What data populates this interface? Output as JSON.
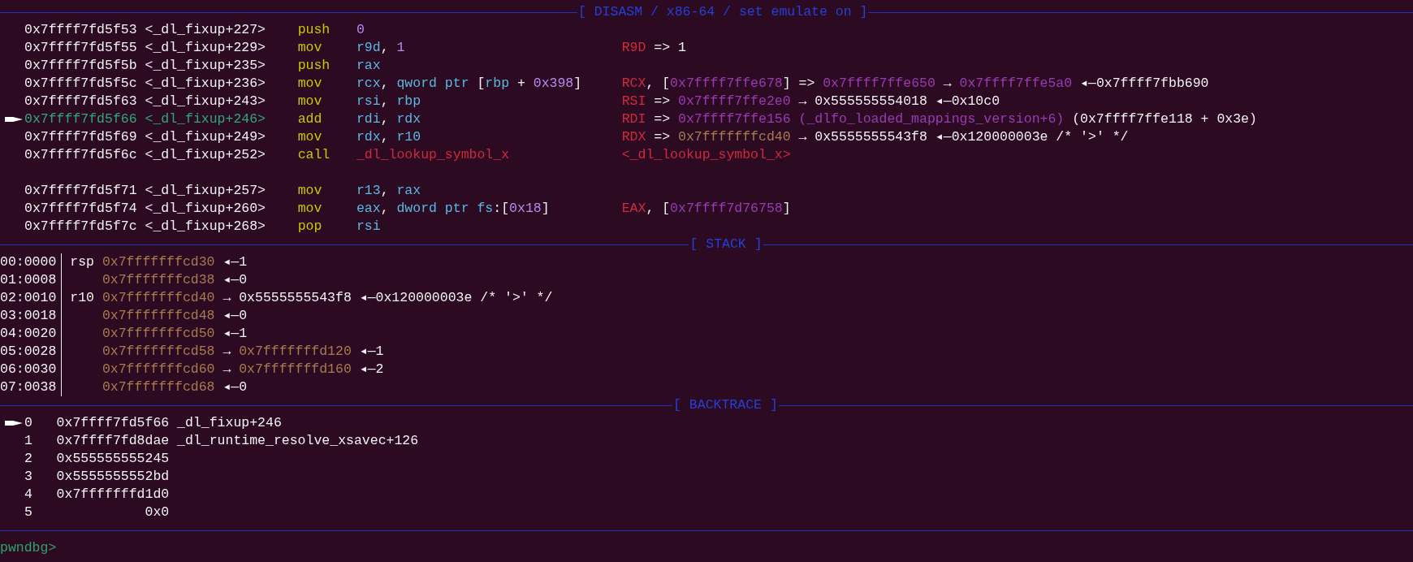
{
  "disasm": {
    "title": "[ DISASM / x86-64 / set emulate on ]",
    "rows": [
      {
        "kind": "instr",
        "current": false,
        "address": "0x7ffff7fd5f53",
        "symbol": "<_dl_fixup+227>",
        "mnemonic": "push",
        "operands": [
          {
            "text": "0",
            "kind": "imm"
          }
        ]
      },
      {
        "kind": "instr",
        "current": false,
        "address": "0x7ffff7fd5f55",
        "symbol": "<_dl_fixup+229>",
        "mnemonic": "mov",
        "operands": [
          {
            "text": "r9d",
            "kind": "reg"
          },
          {
            "text": ",",
            "kind": "text",
            "tight": true
          },
          {
            "text": "1",
            "kind": "imm"
          }
        ],
        "annotation": [
          {
            "text": "R9D",
            "kind": "regname"
          },
          {
            "text": "=>",
            "kind": "text"
          },
          {
            "text": "1",
            "kind": "text"
          }
        ]
      },
      {
        "kind": "instr",
        "current": false,
        "address": "0x7ffff7fd5f5b",
        "symbol": "<_dl_fixup+235>",
        "mnemonic": "push",
        "operands": [
          {
            "text": "rax",
            "kind": "reg"
          }
        ]
      },
      {
        "kind": "instr",
        "current": false,
        "address": "0x7ffff7fd5f5c",
        "symbol": "<_dl_fixup+236>",
        "mnemonic": "mov",
        "operands": [
          {
            "text": "rcx",
            "kind": "reg"
          },
          {
            "text": ",",
            "kind": "text",
            "tight": true
          },
          {
            "text": "qword ptr",
            "kind": "reg"
          },
          {
            "text": "[",
            "kind": "text"
          },
          {
            "text": "rbp",
            "kind": "reg",
            "tight": true
          },
          {
            "text": "+",
            "kind": "text"
          },
          {
            "text": "0x398",
            "kind": "imm"
          },
          {
            "text": "]",
            "kind": "text",
            "tight": true
          }
        ],
        "annotation": [
          {
            "text": "RCX",
            "kind": "regname"
          },
          {
            "text": ",",
            "kind": "text",
            "tight": true
          },
          {
            "text": "[",
            "kind": "text"
          },
          {
            "text": "0x7ffff7ffe678",
            "kind": "heap",
            "tight": true
          },
          {
            "text": "]",
            "kind": "text",
            "tight": true
          },
          {
            "text": "=>",
            "kind": "text"
          },
          {
            "text": "0x7ffff7ffe650",
            "kind": "heap"
          },
          {
            "text": "→",
            "kind": "text"
          },
          {
            "text": "0x7ffff7ffe5a0",
            "kind": "heap"
          },
          {
            "text": "◂—0x7ffff7fbb690",
            "kind": "text"
          }
        ]
      },
      {
        "kind": "instr",
        "current": false,
        "address": "0x7ffff7fd5f63",
        "symbol": "<_dl_fixup+243>",
        "mnemonic": "mov",
        "operands": [
          {
            "text": "rsi",
            "kind": "reg"
          },
          {
            "text": ",",
            "kind": "text",
            "tight": true
          },
          {
            "text": "rbp",
            "kind": "reg"
          }
        ],
        "annotation": [
          {
            "text": "RSI",
            "kind": "regname"
          },
          {
            "text": "=>",
            "kind": "text"
          },
          {
            "text": "0x7ffff7ffe2e0",
            "kind": "heap"
          },
          {
            "text": "→",
            "kind": "text"
          },
          {
            "text": "0x555555554018",
            "kind": "text"
          },
          {
            "text": "◂—0x10c0",
            "kind": "text"
          }
        ]
      },
      {
        "kind": "instr",
        "current": true,
        "address": "0x7ffff7fd5f66",
        "symbol": "<_dl_fixup+246>",
        "mnemonic": "add",
        "operands": [
          {
            "text": "rdi",
            "kind": "reg"
          },
          {
            "text": ",",
            "kind": "text",
            "tight": true
          },
          {
            "text": "rdx",
            "kind": "reg"
          }
        ],
        "annotation": [
          {
            "text": "RDI",
            "kind": "regname"
          },
          {
            "text": "=>",
            "kind": "text"
          },
          {
            "text": "0x7ffff7ffe156",
            "kind": "heap"
          },
          {
            "text": "(_dlfo_loaded_mappings_version+6)",
            "kind": "heap"
          },
          {
            "text": "(0x7ffff7ffe118 + 0x3e)",
            "kind": "text"
          }
        ]
      },
      {
        "kind": "instr",
        "current": false,
        "address": "0x7ffff7fd5f69",
        "symbol": "<_dl_fixup+249>",
        "mnemonic": "mov",
        "operands": [
          {
            "text": "rdx",
            "kind": "reg"
          },
          {
            "text": ",",
            "kind": "text",
            "tight": true
          },
          {
            "text": "r10",
            "kind": "reg"
          }
        ],
        "annotation": [
          {
            "text": "RDX",
            "kind": "regname"
          },
          {
            "text": "=>",
            "kind": "text"
          },
          {
            "text": "0x7fffffffcd40",
            "kind": "stack"
          },
          {
            "text": "→",
            "kind": "text"
          },
          {
            "text": "0x5555555543f8",
            "kind": "text"
          },
          {
            "text": "◂—0x120000003e /* '>' */",
            "kind": "text"
          }
        ]
      },
      {
        "kind": "call",
        "current": false,
        "address": "0x7ffff7fd5f6c",
        "symbol": "<_dl_fixup+252>",
        "mnemonic": "call",
        "operands": [
          {
            "text": "_dl_lookup_symbol_x",
            "kind": "code"
          }
        ],
        "annotation": [
          {
            "text": "<_dl_lookup_symbol_x>",
            "kind": "code"
          }
        ]
      },
      {
        "kind": "instr",
        "current": false,
        "address": "0x7ffff7fd5f71",
        "symbol": "<_dl_fixup+257>",
        "mnemonic": "mov",
        "operands": [
          {
            "text": "r13",
            "kind": "reg"
          },
          {
            "text": ",",
            "kind": "text",
            "tight": true
          },
          {
            "text": "rax",
            "kind": "reg"
          }
        ]
      },
      {
        "kind": "instr",
        "current": false,
        "address": "0x7ffff7fd5f74",
        "symbol": "<_dl_fixup+260>",
        "mnemonic": "mov",
        "operands": [
          {
            "text": "eax",
            "kind": "reg"
          },
          {
            "text": ",",
            "kind": "text",
            "tight": true
          },
          {
            "text": "dword ptr fs",
            "kind": "reg"
          },
          {
            "text": ":",
            "kind": "text",
            "tight": true
          },
          {
            "text": "[",
            "kind": "text",
            "tight": true
          },
          {
            "text": "0x18",
            "kind": "imm",
            "tight": true
          },
          {
            "text": "]",
            "kind": "text",
            "tight": true
          }
        ],
        "annotation": [
          {
            "text": "EAX",
            "kind": "regname"
          },
          {
            "text": ",",
            "kind": "text",
            "tight": true
          },
          {
            "text": "[",
            "kind": "text"
          },
          {
            "text": "0x7ffff7d76758",
            "kind": "heap",
            "tight": true
          },
          {
            "text": "]",
            "kind": "text",
            "tight": true
          }
        ]
      },
      {
        "kind": "instr",
        "current": false,
        "address": "0x7ffff7fd5f7c",
        "symbol": "<_dl_fixup+268>",
        "mnemonic": "pop",
        "operands": [
          {
            "text": "rsi",
            "kind": "reg"
          }
        ]
      }
    ]
  },
  "stack": {
    "title": "[ STACK ]",
    "rows": [
      {
        "index": "00:0000",
        "register": "rsp",
        "values": [
          {
            "text": "0x7fffffffcd30",
            "kind": "stack"
          },
          {
            "text": "◂—1",
            "kind": "text"
          }
        ]
      },
      {
        "index": "01:0008",
        "values": [
          {
            "text": "0x7fffffffcd38",
            "kind": "stack"
          },
          {
            "text": "◂—0",
            "kind": "text"
          }
        ]
      },
      {
        "index": "02:0010",
        "register": "r10",
        "values": [
          {
            "text": "0x7fffffffcd40",
            "kind": "stack"
          },
          {
            "text": "→",
            "kind": "text"
          },
          {
            "text": "0x5555555543f8",
            "kind": "text"
          },
          {
            "text": "◂—0x120000003e /* '>' */",
            "kind": "text"
          }
        ]
      },
      {
        "index": "03:0018",
        "values": [
          {
            "text": "0x7fffffffcd48",
            "kind": "stack"
          },
          {
            "text": "◂—0",
            "kind": "text"
          }
        ]
      },
      {
        "index": "04:0020",
        "values": [
          {
            "text": "0x7fffffffcd50",
            "kind": "stack"
          },
          {
            "text": "◂—1",
            "kind": "text"
          }
        ]
      },
      {
        "index": "05:0028",
        "values": [
          {
            "text": "0x7fffffffcd58",
            "kind": "stack"
          },
          {
            "text": "→",
            "kind": "text"
          },
          {
            "text": "0x7fffffffd120",
            "kind": "stack"
          },
          {
            "text": "◂—1",
            "kind": "text"
          }
        ]
      },
      {
        "index": "06:0030",
        "values": [
          {
            "text": "0x7fffffffcd60",
            "kind": "stack"
          },
          {
            "text": "→",
            "kind": "text"
          },
          {
            "text": "0x7fffffffd160",
            "kind": "stack"
          },
          {
            "text": "◂—2",
            "kind": "text"
          }
        ]
      },
      {
        "index": "07:0038",
        "values": [
          {
            "text": "0x7fffffffcd68",
            "kind": "stack"
          },
          {
            "text": "◂—0",
            "kind": "text"
          }
        ]
      }
    ]
  },
  "backtrace": {
    "title": "[ BACKTRACE ]",
    "frames": [
      {
        "current": true,
        "index": "0",
        "address": "0x7ffff7fd5f66",
        "symbol": "_dl_fixup+246"
      },
      {
        "current": false,
        "index": "1",
        "address": "0x7ffff7fd8dae",
        "symbol": "_dl_runtime_resolve_xsavec+126"
      },
      {
        "current": false,
        "index": "2",
        "address": "0x555555555245"
      },
      {
        "current": false,
        "index": "3",
        "address": "0x5555555552bd"
      },
      {
        "current": false,
        "index": "4",
        "address": "0x7fffffffd1d0"
      },
      {
        "current": false,
        "index": "5",
        "address": "0x0"
      }
    ]
  },
  "prompt": "pwndbg>"
}
